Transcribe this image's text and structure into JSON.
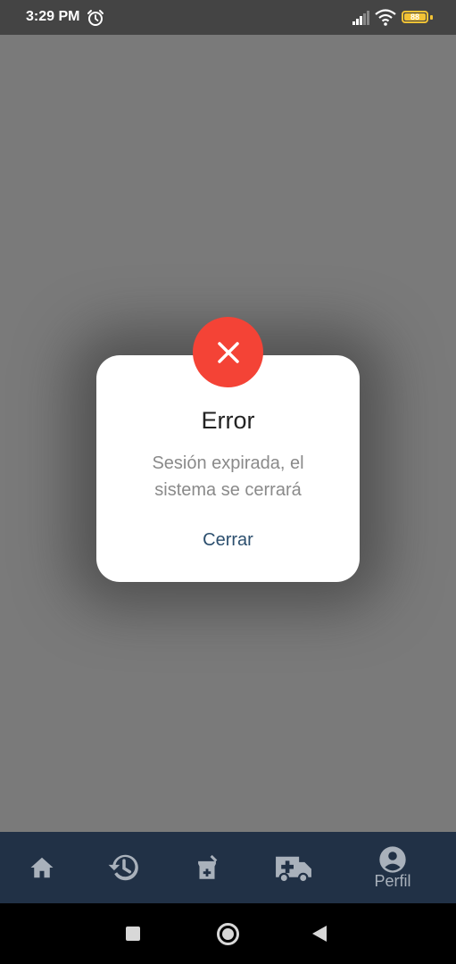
{
  "status_bar": {
    "time": "3:29 PM",
    "battery": "88",
    "icons": [
      "alarm-icon",
      "signal-icon",
      "wifi-icon",
      "battery-icon"
    ]
  },
  "dialog": {
    "icon": "close-icon",
    "title": "Error",
    "message_line1": "Sesión expirada, el",
    "message_line2": "sistema se cerrará",
    "button_label": "Cerrar",
    "accent_color": "#f44336",
    "button_color": "#2c4f6e"
  },
  "bottom_nav": {
    "items": [
      {
        "icon": "home-icon",
        "label": ""
      },
      {
        "icon": "history-icon",
        "label": ""
      },
      {
        "icon": "medicine-icon",
        "label": ""
      },
      {
        "icon": "ambulance-icon",
        "label": ""
      },
      {
        "icon": "account-circle-icon",
        "label": "Perfil"
      }
    ],
    "background": "#213146"
  },
  "system_nav": {
    "icons": [
      "recents-square-icon",
      "home-circle-icon",
      "back-triangle-icon"
    ]
  }
}
